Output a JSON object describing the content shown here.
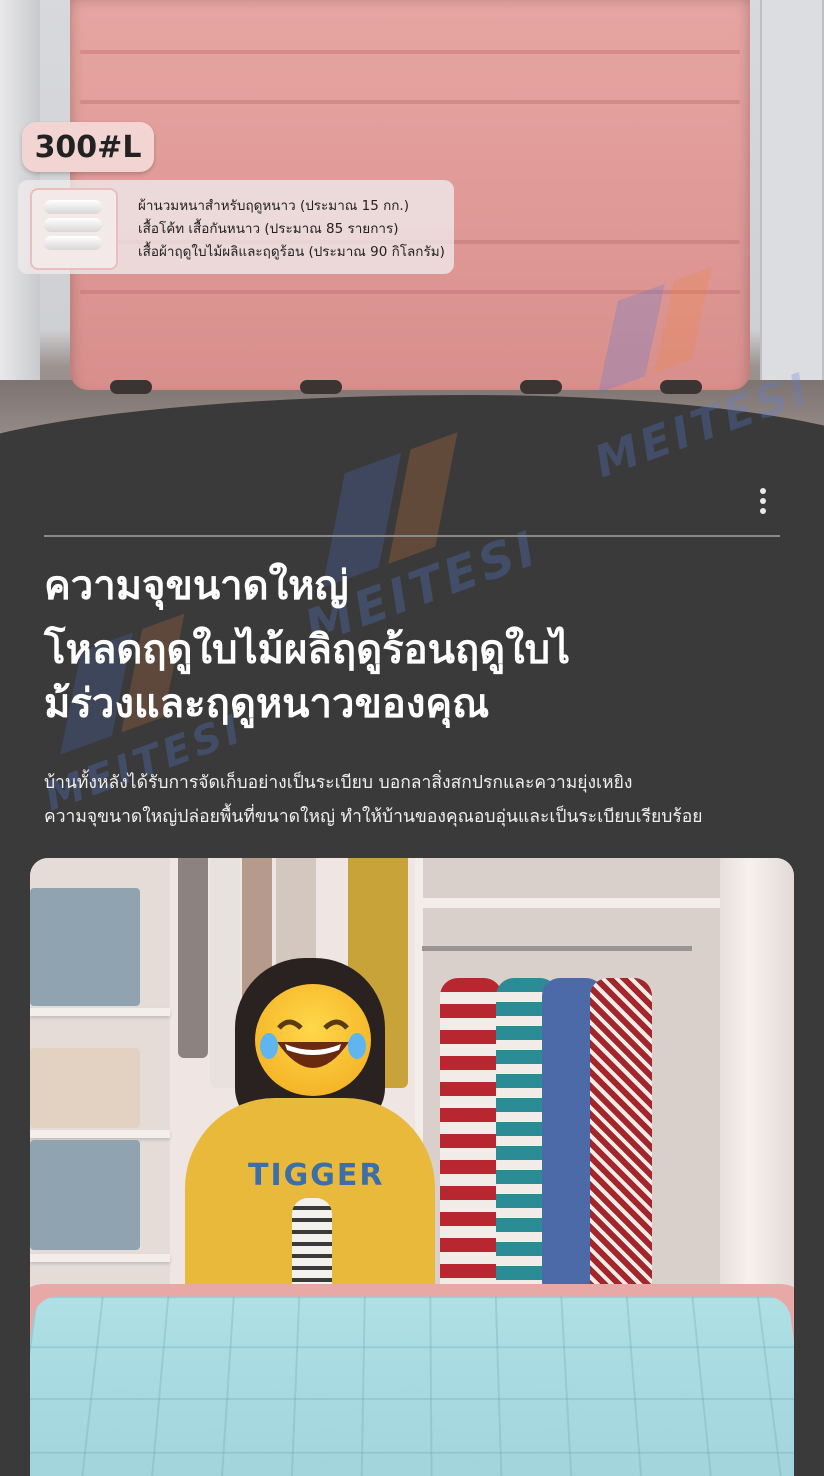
{
  "hero": {
    "capacity_badge": "300#L",
    "capacity_lines": [
      "ผ้านวมหนาสำหรับฤดูหนาว (ประมาณ 15 กก.)",
      "เสื้อโค้ท เสื้อกันหนาว (ประมาณ 85 รายการ)",
      "เสื้อผ้าฤดูใบไม้ผลิและฤดูร้อน (ประมาณ 90 กิโลกรัม)"
    ]
  },
  "watermark": {
    "brand": "MEITESI"
  },
  "content": {
    "headline_lines": [
      "ความจุขนาดใหญ่",
      "โหลดฤดูใบไม้ผลิฤดูร้อนฤดูใบไ",
      "ม้ร่วงและฤดูหนาวของคุณ"
    ],
    "body_lines": [
      "บ้านทั้งหลังได้รับการจัดเก็บอย่างเป็นระเบียบ บอกลาสิ่งสกปรกและความยุ่งเหยิง",
      "ความจุขนาดใหญ่ปล่อยพื้นที่ขนาดใหญ่ ทำให้บ้านของคุณอบอุ่นและเป็นระเบียบเรียบร้อย"
    ]
  },
  "photo": {
    "shirt_print": "TIGGER"
  }
}
